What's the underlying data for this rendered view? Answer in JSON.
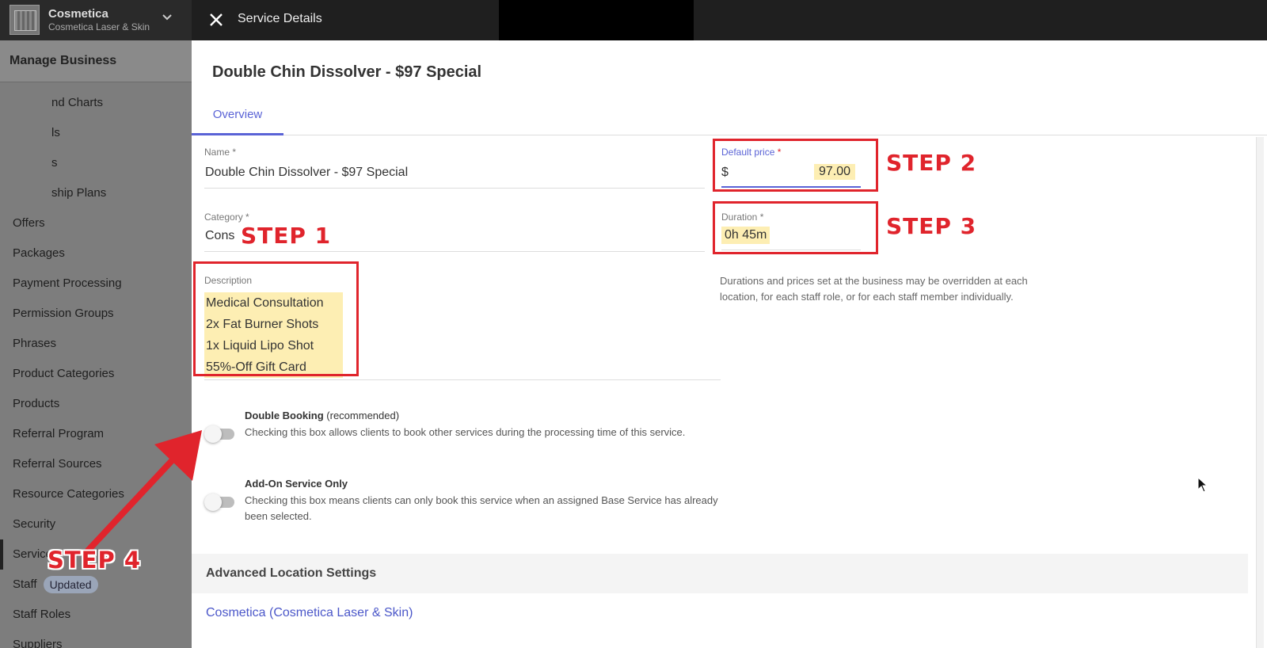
{
  "app": {
    "business_name": "Cosmetica",
    "business_sub": "Cosmetica Laser & Skin",
    "panel_title": "Service Details"
  },
  "sidebar": {
    "header": "Manage Business",
    "items": [
      {
        "label": "nd Charts",
        "badge": ""
      },
      {
        "label": "ls",
        "badge": ""
      },
      {
        "label": "s",
        "badge": ""
      },
      {
        "label": "ship Plans",
        "badge": ""
      },
      {
        "label": "Offers",
        "badge": ""
      },
      {
        "label": "Packages",
        "badge": ""
      },
      {
        "label": "Payment Processing",
        "badge": ""
      },
      {
        "label": "Permission Groups",
        "badge": ""
      },
      {
        "label": "Phrases",
        "badge": ""
      },
      {
        "label": "Product Categories",
        "badge": ""
      },
      {
        "label": "Products",
        "badge": ""
      },
      {
        "label": "Referral Program",
        "badge": ""
      },
      {
        "label": "Referral Sources",
        "badge": ""
      },
      {
        "label": "Resource Categories",
        "badge": ""
      },
      {
        "label": "Security",
        "badge": ""
      },
      {
        "label": "Services",
        "badge": ""
      },
      {
        "label": "Staff",
        "badge": "Updated"
      },
      {
        "label": "Staff Roles",
        "badge": ""
      },
      {
        "label": "Suppliers",
        "badge": ""
      }
    ]
  },
  "service": {
    "title": "Double Chin Dissolver - $97 Special",
    "tab_overview": "Overview",
    "name_label": "Name",
    "name_value": "Double Chin Dissolver - $97 Special",
    "category_label": "Category",
    "category_value": "Cons",
    "description_label": "Description",
    "description_lines": [
      "Medical Consultation",
      "2x Fat Burner Shots",
      "1x Liquid Lipo Shot",
      "55%-Off Gift Card"
    ],
    "price_label": "Default price",
    "price_currency": "$",
    "price_value": "97.00",
    "duration_label": "Duration *",
    "duration_value": "0h 45m",
    "helper_text": "Durations and prices set at the business may be overridden at each location, for each staff role, or for each staff member individually.",
    "required_mark": "*"
  },
  "options": {
    "double_booking_title": "Double Booking",
    "double_booking_hint": "(recommended)",
    "double_booking_desc": "Checking this box allows clients to book other services during the processing time of this service.",
    "addon_title": "Add-On Service Only",
    "addon_desc": "Checking this box means clients can only book this service when an assigned Base Service has already been selected."
  },
  "advanced": {
    "header": "Advanced Location Settings",
    "location_link": "Cosmetica (Cosmetica Laser & Skin)"
  },
  "annotations": {
    "step1": "STEP 1",
    "step2": "STEP 2",
    "step3": "STEP 3",
    "step4": "STEP 4",
    "color": "#e0242c"
  },
  "colors": {
    "accent": "#5a63d6",
    "highlight": "#fdeeb3"
  }
}
